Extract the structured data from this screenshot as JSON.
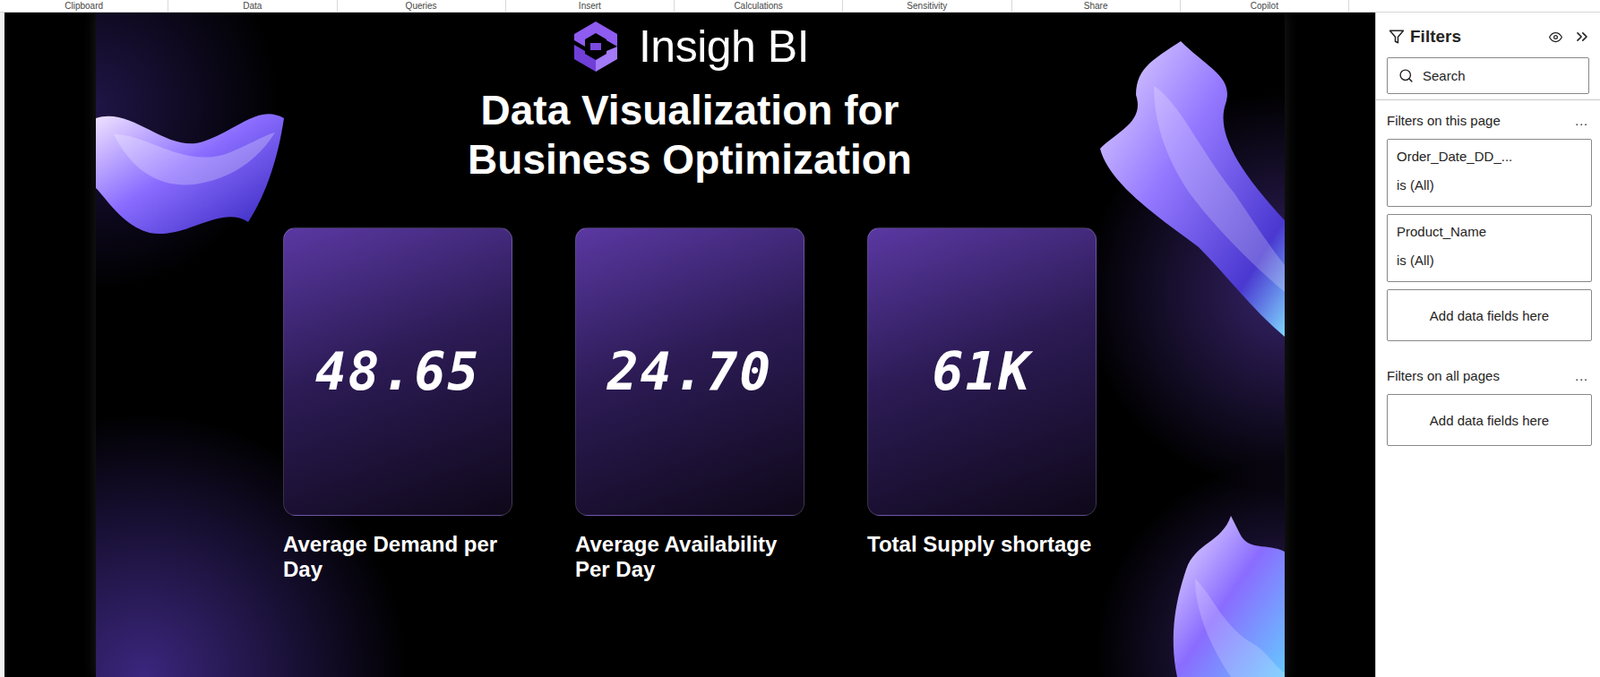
{
  "ribbon": {
    "groups": [
      "Clipboard",
      "Data",
      "Queries",
      "Insert",
      "Calculations",
      "Sensitivity",
      "Share",
      "Copilot"
    ]
  },
  "report": {
    "logo": "Insigh BI",
    "title": [
      "Data Visualization for",
      "Business Optimization"
    ],
    "cards": [
      {
        "value": "48.65",
        "label": "Average Demand per Day"
      },
      {
        "value": "24.70",
        "label": "Average Availability Per Day"
      },
      {
        "value": "61K",
        "label": "Total Supply shortage"
      }
    ]
  },
  "filters": {
    "title": "Filters",
    "search": {
      "placeholder": "Search"
    },
    "sections": [
      {
        "title": "Filters on this page",
        "menu": "...",
        "items": [
          {
            "kind": "filter",
            "field": "Order_Date_DD_...",
            "condition": "is (All)"
          },
          {
            "kind": "filter",
            "field": "Product_Name",
            "condition": "is (All)"
          },
          {
            "kind": "add",
            "label": "Add data fields here"
          }
        ]
      },
      {
        "title": "Filters on all pages",
        "menu": "...",
        "items": [
          {
            "kind": "add",
            "label": "Add data fields here"
          }
        ]
      }
    ]
  }
}
